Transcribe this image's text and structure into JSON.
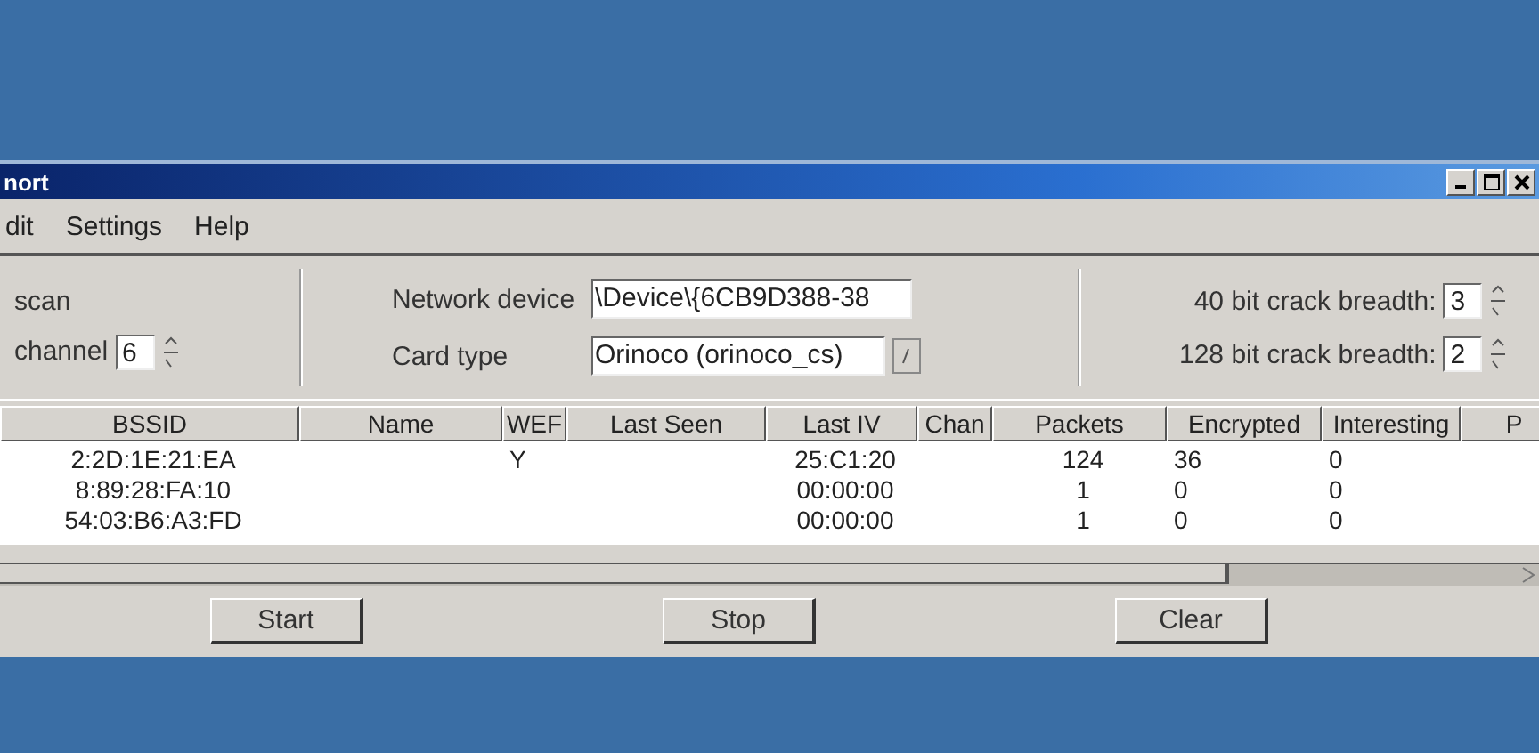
{
  "window": {
    "title": "nort"
  },
  "menu": [
    "dit",
    "Settings",
    "Help"
  ],
  "left": {
    "scan_label": "scan",
    "channel_label": "channel",
    "channel_value": "6"
  },
  "middle": {
    "device_label": "Network device",
    "device_value": "\\Device\\{6CB9D388-38",
    "card_label": "Card type",
    "card_value": "Orinoco (orinoco_cs)"
  },
  "right": [
    {
      "label": "40 bit crack breadth:",
      "value": "3"
    },
    {
      "label": "128 bit crack breadth:",
      "value": "2"
    }
  ],
  "table": {
    "columns": [
      "BSSID",
      "Name",
      "WEF",
      "Last Seen",
      "Last IV",
      "Chan",
      "Packets",
      "Encrypted",
      "Interesting",
      "P"
    ],
    "rows": [
      [
        "2:2D:1E:21:EA",
        "",
        "Y",
        "",
        "25:C1:20",
        "",
        "124",
        "36",
        "0",
        ""
      ],
      [
        "8:89:28:FA:10",
        "",
        "",
        "",
        "00:00:00",
        "",
        "1",
        "0",
        "0",
        ""
      ],
      [
        "54:03:B6:A3:FD",
        "",
        "",
        "",
        "00:00:00",
        "",
        "1",
        "0",
        "0",
        ""
      ]
    ]
  },
  "buttons": [
    "Start",
    "Stop",
    "Clear"
  ]
}
